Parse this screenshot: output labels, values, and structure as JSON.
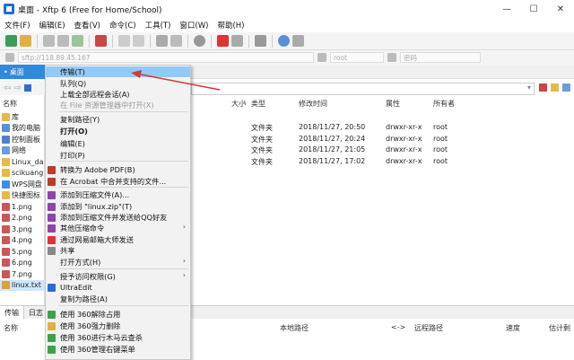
{
  "window": {
    "title": "桌面 - Xftp 6 (Free for Home/School)",
    "controls": [
      "—",
      "☐",
      "✕"
    ]
  },
  "menubar": [
    "文件(F)",
    "编辑(E)",
    "查看(V)",
    "命令(C)",
    "工具(T)",
    "窗口(W)",
    "帮助(H)"
  ],
  "address": {
    "host": "sftp://118.89.45.167",
    "user": "root",
    "password": "密码"
  },
  "left_pane": {
    "tab_label": "桌面",
    "header": "名称",
    "files": [
      {
        "name": "库",
        "icon": "folder-icon",
        "color": "#e9b84a"
      },
      {
        "name": "我的电脑",
        "icon": "computer-icon",
        "color": "#5a8fd6"
      },
      {
        "name": "控制面板",
        "icon": "control-panel-icon",
        "color": "#4f7fcf"
      },
      {
        "name": "网络",
        "icon": "network-icon",
        "color": "#6a9ed9"
      },
      {
        "name": "Linux_da",
        "icon": "folder-icon",
        "color": "#e9b84a"
      },
      {
        "name": "scikuang",
        "icon": "folder-icon",
        "color": "#e9b84a"
      },
      {
        "name": "WPS网盘",
        "icon": "cloud-icon",
        "color": "#3a8ee6"
      },
      {
        "name": "快捷图标",
        "icon": "folder-icon",
        "color": "#e9b84a"
      },
      {
        "name": "1.png",
        "icon": "image-file-icon",
        "color": "#c55"
      },
      {
        "name": "2.png",
        "icon": "image-file-icon",
        "color": "#c55"
      },
      {
        "name": "3.png",
        "icon": "image-file-icon",
        "color": "#c55"
      },
      {
        "name": "4.png",
        "icon": "image-file-icon",
        "color": "#c55"
      },
      {
        "name": "5.png",
        "icon": "image-file-icon",
        "color": "#c55"
      },
      {
        "name": "6.png",
        "icon": "image-file-icon",
        "color": "#c55"
      },
      {
        "name": "7.png",
        "icon": "image-file-icon",
        "color": "#c55"
      },
      {
        "name": "linux.txt",
        "icon": "text-file-icon",
        "color": "#d9a23a"
      }
    ]
  },
  "right_pane": {
    "columns": {
      "size": "大小",
      "type": "类型",
      "mtime": "修改时间",
      "attr": "属性",
      "owner": "所有者"
    },
    "rows": [
      {
        "type": "文件夹",
        "mtime": "2018/11/27, 20:50",
        "attr": "drwxr-xr-x",
        "owner": "root"
      },
      {
        "type": "文件夹",
        "mtime": "2018/11/27, 20:24",
        "attr": "drwxr-xr-x",
        "owner": "root"
      },
      {
        "type": "文件夹",
        "mtime": "2018/11/27, 21:05",
        "attr": "drwxr-xr-x",
        "owner": "root"
      },
      {
        "type": "文件夹",
        "mtime": "2018/11/27, 17:02",
        "attr": "drwxr-xr-x",
        "owner": "root"
      }
    ]
  },
  "context_menu": {
    "items": [
      {
        "label": "传输(T)",
        "state": "highlighted",
        "icon": ""
      },
      {
        "label": "队列(Q)",
        "state": "normal",
        "icon": ""
      },
      {
        "label": "上载全部远程会话(A)",
        "state": "normal",
        "icon": ""
      },
      {
        "label": "在 File 资源管理器中打开(X)",
        "state": "disabled",
        "icon": ""
      },
      {
        "label": "复制路径(Y)",
        "state": "normal",
        "icon": ""
      },
      {
        "label": "打开(O)",
        "state": "bold",
        "icon": ""
      },
      {
        "label": "编辑(E)",
        "state": "normal",
        "icon": ""
      },
      {
        "label": "打印(P)",
        "state": "normal",
        "icon": ""
      },
      {
        "label": "转换为 Adobe PDF(B)",
        "state": "normal",
        "icon": "pdf-icon"
      },
      {
        "label": "在 Acrobat 中合并支持的文件...",
        "state": "normal",
        "icon": "acrobat-icon"
      },
      {
        "label": "添加到压缩文件(A)...",
        "state": "normal",
        "icon": "archive-icon"
      },
      {
        "label": "添加到 \"linux.zip\"(T)",
        "state": "normal",
        "icon": "archive-icon"
      },
      {
        "label": "添加到压缩文件并发送给QQ好友",
        "state": "normal",
        "icon": "archive-icon"
      },
      {
        "label": "其他压缩命令",
        "state": "submenu",
        "icon": "archive-icon"
      },
      {
        "label": "通过网易邮箱大师发送",
        "state": "normal",
        "icon": "mail-icon"
      },
      {
        "label": "共享",
        "state": "normal",
        "icon": "share-icon"
      },
      {
        "label": "打开方式(H)",
        "state": "submenu",
        "icon": ""
      },
      {
        "label": "授予访问权限(G)",
        "state": "submenu",
        "icon": ""
      },
      {
        "label": "UltraEdit",
        "state": "normal",
        "icon": "ultraedit-icon"
      },
      {
        "label": "复制为路径(A)",
        "state": "normal",
        "icon": ""
      },
      {
        "label": "使用 360解除占用",
        "state": "normal",
        "icon": "360-unlock-icon"
      },
      {
        "label": "使用 360强力删除",
        "state": "normal",
        "icon": "360-delete-icon"
      },
      {
        "label": "使用 360进行木马云查杀",
        "state": "normal",
        "icon": "360-scan-icon"
      },
      {
        "label": "使用 360管理右键菜单",
        "state": "normal",
        "icon": "360-manage-icon"
      }
    ]
  },
  "bottom": {
    "tabs": [
      "传输",
      "日志"
    ],
    "columns": {
      "name": "名称",
      "status": "状态",
      "progress": "进度",
      "size": "大小",
      "local_path": "本地路径",
      "direction": "<->",
      "remote_path": "远程路径",
      "speed": "速度",
      "eta": "估计剩"
    }
  },
  "colors": {
    "accent": "#2d8ae0",
    "menu_highlight": "#91c9f7",
    "annotation_arrow": "#d23a3a"
  }
}
